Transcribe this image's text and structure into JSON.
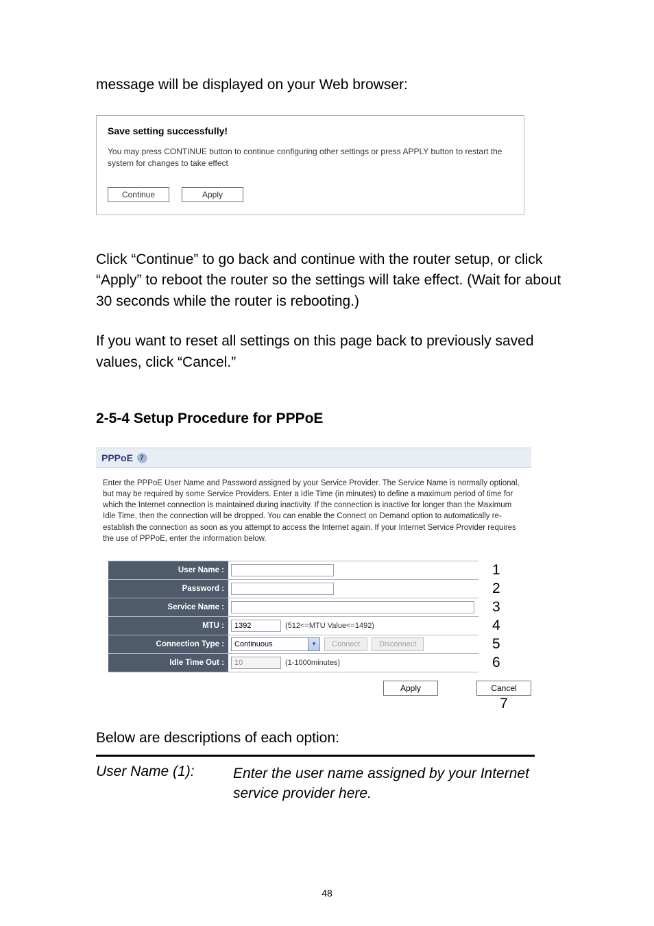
{
  "intro": "message will be displayed on your Web browser:",
  "save_panel": {
    "title": "Save setting successfully!",
    "msg": "You may press CONTINUE button to continue configuring other settings or press APPLY button to restart the system for changes to take effect",
    "continue": "Continue",
    "apply": "Apply"
  },
  "body1": "Click “Continue” to go back and continue with the router setup, or click “Apply” to reboot the router so the settings will take effect. (Wait for about 30 seconds while the router is rebooting.)",
  "body2": "If you want to reset all settings on this page back to previously saved values, click “Cancel.”",
  "heading": "2-5-4 Setup Procedure for PPPoE",
  "pppoe": {
    "title": "PPPoE",
    "desc": "Enter the PPPoE User Name and Password assigned by your Service Provider. The Service Name is normally optional, but may be required by some Service Providers. Enter a Idle Time (in minutes) to define a maximum period of time for which the Internet connection is maintained during inactivity. If the connection is inactive for longer than the Maximum Idle Time, then the connection will be dropped. You can enable the Connect on Demand option to automatically re-establish the connection as soon as you attempt to access the Internet again.\nIf your Internet Service Provider requires the use of PPPoE, enter the information below.",
    "rows": {
      "user_name": "User Name :",
      "password": "Password :",
      "service_name": "Service Name :",
      "mtu": "MTU :",
      "conn_type": "Connection Type :",
      "idle": "Idle Time Out :"
    },
    "mtu_value": "1392",
    "mtu_hint": "(512<=MTU Value<=1492)",
    "conn_value": "Continuous",
    "connect": "Connect",
    "disconnect": "Disconnect",
    "idle_value": "10",
    "idle_hint": "(1-1000minutes)",
    "apply": "Apply",
    "cancel": "Cancel"
  },
  "annotations": {
    "n1": "1",
    "n2": "2",
    "n3": "3",
    "n4": "4",
    "n5": "5",
    "n6": "6",
    "n7": "7"
  },
  "below": "Below are descriptions of each option:",
  "desc": {
    "label": "User Name (1):",
    "text": "Enter the user name assigned by your Internet service provider here."
  },
  "pageno": "48"
}
